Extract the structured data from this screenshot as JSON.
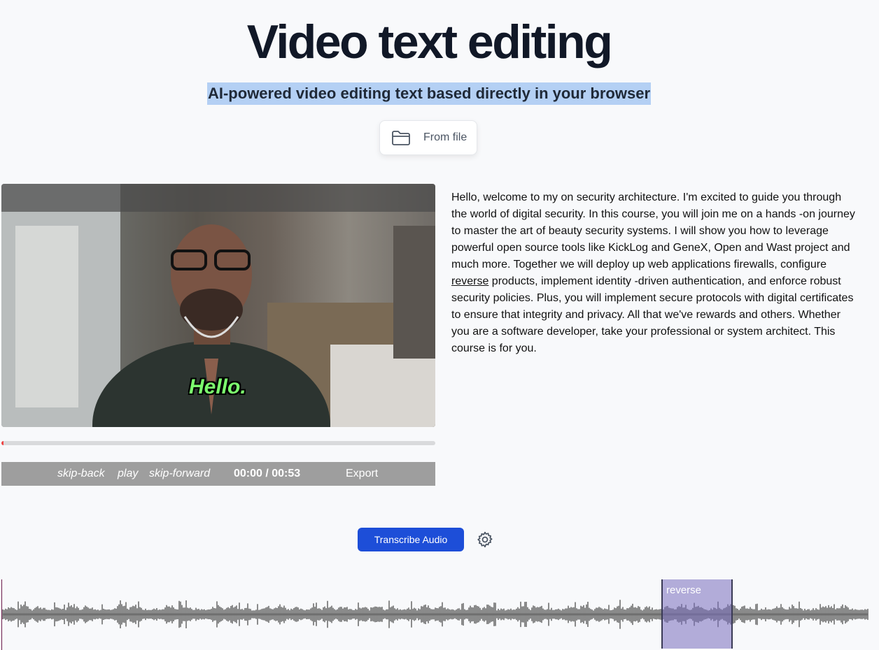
{
  "header": {
    "title": "Video text editing",
    "subtitle": "AI-powered video editing text based directly in your browser",
    "from_file_label": "From file"
  },
  "player": {
    "caption": "Hello.",
    "progress": 0.005,
    "controls": {
      "skip_back": "skip-back",
      "play": "play",
      "skip_forward": "skip-forward",
      "time": "00:00 / 00:53",
      "export": "Export"
    }
  },
  "transcript": {
    "before": "Hello, welcome to my on security architecture. I'm excited to guide you through the world of digital security. In this course, you will join me on a hands -on journey to master the art of beauty security systems. I will show you how to leverage powerful open source tools like KickLog and GeneX, Open and Wast project and much more. Together we will deploy up web applications firewalls, configure ",
    "highlight": "reverse",
    "after": " products, implement identity -driven authentication, and enforce robust security policies. Plus, you will implement secure protocols with digital certificates to ensure that integrity and privacy. All that we've rewards and others. Whether you are a software developer, take your professional or system architect. This course is for you."
  },
  "actions": {
    "transcribe_label": "Transcribe Audio"
  },
  "waveform": {
    "region_label": "reverse"
  },
  "icons": {
    "folder": "folder-icon",
    "settings": "gear-icon"
  },
  "colors": {
    "accent": "#1d4ed8",
    "highlight": "#b4d0f4",
    "region": "#786ebe",
    "caption": "#7cff6e"
  }
}
